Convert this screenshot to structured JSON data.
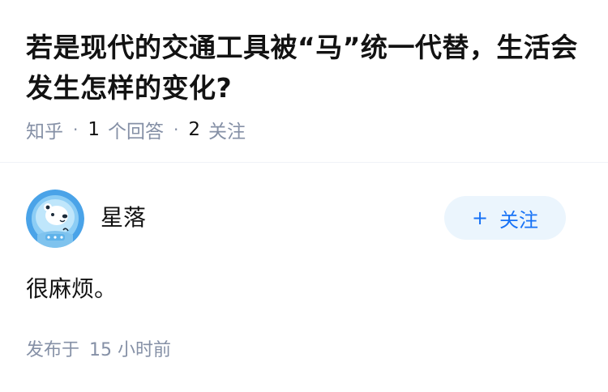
{
  "question": {
    "title": "若是现代的交通工具被“马”统一代替，生活会发生怎样的变化?",
    "source": "知乎",
    "separator": "·",
    "answers_count": "1",
    "answers_label": "个回答",
    "followers_count": "2",
    "followers_label": "关注"
  },
  "answer": {
    "author_name": "星落",
    "follow_plus": "+",
    "follow_label": "关注",
    "content": "很麻烦。",
    "published_prefix": "发布于",
    "published_time": "15 小时前"
  },
  "colors": {
    "text": "#121212",
    "meta": "#8590a6",
    "accent": "#1772f6",
    "button_bg": "#ebf5fd",
    "avatar_bg": "#4aa3e8"
  },
  "icons": {
    "avatar": "bear-astronaut-avatar"
  }
}
